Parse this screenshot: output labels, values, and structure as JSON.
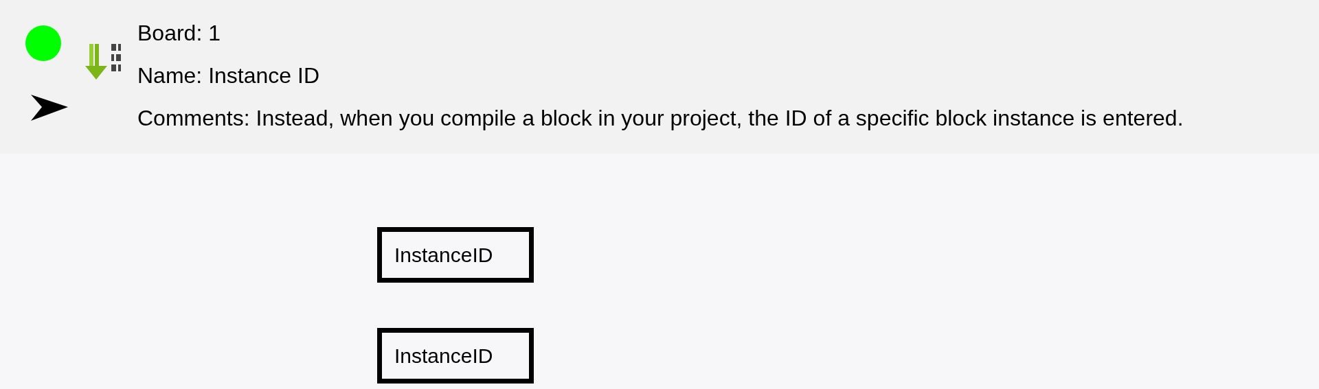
{
  "header": {
    "lines": [
      "Board: 1",
      "Name: Instance ID",
      "Comments: Instead, when you compile a block in your project, the ID of a specific block instance is entered."
    ]
  },
  "blocks": [
    {
      "label": "InstanceID"
    },
    {
      "label": "InstanceID"
    }
  ]
}
